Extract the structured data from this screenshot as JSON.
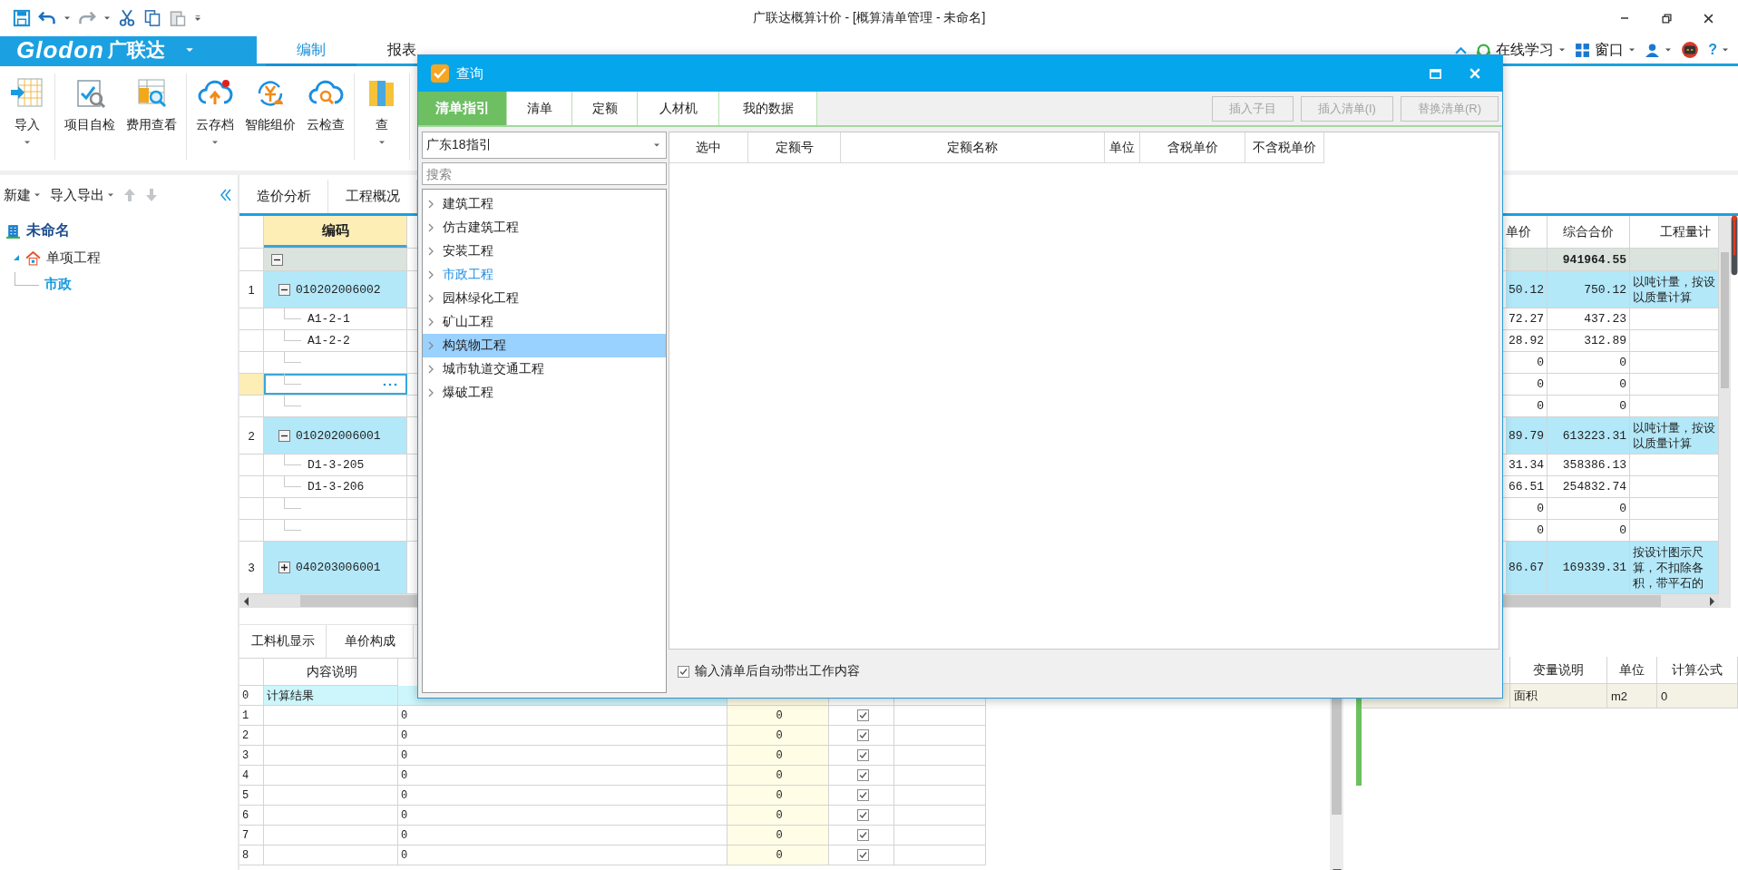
{
  "window": {
    "title": "广联达概算计价 - [概算清单管理 - 未命名]"
  },
  "logo": {
    "brand": "Glodon",
    "name": "广联达"
  },
  "ribbon_tabs": [
    {
      "label": "编制",
      "selected": true
    },
    {
      "label": "报表",
      "selected": false
    }
  ],
  "top_links": [
    {
      "kind": "learning",
      "label": "在线学习",
      "dropdown": true
    },
    {
      "kind": "window",
      "label": "窗口",
      "dropdown": true
    },
    {
      "kind": "user",
      "dropdown": true
    },
    {
      "kind": "assistant",
      "dropdown": false
    },
    {
      "kind": "help",
      "label": "?",
      "dropdown": true
    }
  ],
  "ribbon_groups": [
    {
      "buttons": [
        {
          "kind": "import",
          "label": "导入",
          "dropdown": true
        }
      ]
    },
    {
      "buttons": [
        {
          "kind": "self-check",
          "label": "项目自检",
          "dropdown": false
        },
        {
          "kind": "cost-view",
          "label": "费用查看",
          "dropdown": false
        }
      ]
    },
    {
      "buttons": [
        {
          "kind": "cloud-save",
          "label": "云存档",
          "dropdown": true
        },
        {
          "kind": "smart-price",
          "label": "智能组价",
          "dropdown": false
        },
        {
          "kind": "cloud-check",
          "label": "云检查",
          "dropdown": false
        }
      ]
    },
    {
      "buttons": [
        {
          "kind": "query",
          "label": "查",
          "dropdown": true
        }
      ]
    }
  ],
  "sidebar": {
    "toolbar": [
      {
        "label": "新建"
      },
      {
        "label": "导入导出"
      }
    ],
    "tree": [
      {
        "kind": "project",
        "label": "未命名",
        "children": [
          {
            "kind": "single",
            "label": "单项工程",
            "expanded": true,
            "children": [
              {
                "kind": "unit",
                "label": "市政",
                "selected": true
              }
            ]
          }
        ]
      }
    ]
  },
  "main_tabs": [
    {
      "label": "造价分析"
    },
    {
      "label": "工程概况"
    }
  ],
  "grid": {
    "columns": [
      "编码",
      "单价",
      "综合合价",
      "工程量计"
    ],
    "rows": [
      {
        "kind": "summary",
        "expanded": true,
        "total": "941964.55"
      },
      {
        "kind": "item",
        "number": "1",
        "code": "010202006002",
        "expanded": true,
        "price": "50.12",
        "total": "750.12",
        "note": [
          "以吨计量，按设",
          "以质量计算"
        ]
      },
      {
        "kind": "sub",
        "code": "A1-2-1",
        "price": "72.27",
        "total": "437.23"
      },
      {
        "kind": "sub",
        "code": "A1-2-2",
        "price": "28.92",
        "total": "312.89"
      },
      {
        "kind": "sub",
        "price": "0",
        "total": "0"
      },
      {
        "kind": "sub",
        "editing": true,
        "price": "0",
        "total": "0"
      },
      {
        "kind": "sub",
        "price": "0",
        "total": "0"
      },
      {
        "kind": "item",
        "number": "2",
        "code": "010202006001",
        "expanded": true,
        "price": "89.79",
        "total": "613223.31",
        "note": [
          "以吨计量，按设",
          "以质量计算"
        ]
      },
      {
        "kind": "sub",
        "code": "D1-3-205",
        "price": "31.34",
        "total": "358386.13"
      },
      {
        "kind": "sub",
        "code": "D1-3-206",
        "price": "66.51",
        "total": "254832.74"
      },
      {
        "kind": "sub",
        "price": "0",
        "total": "0"
      },
      {
        "kind": "sub",
        "price": "0",
        "total": "0"
      },
      {
        "kind": "item",
        "number": "3",
        "code": "040203006001",
        "expanded": false,
        "price": "86.67",
        "total": "169339.31",
        "note": [
          "按设计图示尺",
          "算，不扣除各",
          "积，带平石的"
        ]
      }
    ]
  },
  "detail_tabs": [
    {
      "label": "工料机显示"
    },
    {
      "label": "单价构成"
    }
  ],
  "calc_table": {
    "column": "内容说明",
    "rows": [
      {
        "kind": "result",
        "number": "0",
        "label": "计算结果"
      },
      {
        "kind": "item",
        "number": "1",
        "value": "0",
        "amount": "0",
        "checked": true
      },
      {
        "kind": "item",
        "number": "2",
        "value": "0",
        "amount": "0",
        "checked": true
      },
      {
        "kind": "item",
        "number": "3",
        "value": "0",
        "amount": "0",
        "checked": true
      },
      {
        "kind": "item",
        "number": "4",
        "value": "0",
        "amount": "0",
        "checked": true
      },
      {
        "kind": "item",
        "number": "5",
        "value": "0",
        "amount": "0",
        "checked": true
      },
      {
        "kind": "item",
        "number": "6",
        "value": "0",
        "amount": "0",
        "checked": true
      },
      {
        "kind": "item",
        "number": "7",
        "value": "0",
        "amount": "0",
        "checked": true
      },
      {
        "kind": "item",
        "number": "8",
        "value": "0",
        "amount": "0",
        "checked": true
      }
    ]
  },
  "variables": {
    "columns": [
      "变量说明",
      "单位",
      "计算公式"
    ],
    "rows": [
      {
        "label": "面积",
        "unit": "m2",
        "formula": "0"
      }
    ]
  },
  "query_dialog": {
    "title": "查询",
    "tabs": [
      {
        "label": "清单指引",
        "selected": true
      },
      {
        "label": "清单",
        "selected": false
      },
      {
        "label": "定额",
        "selected": false
      },
      {
        "label": "人材机",
        "selected": false
      },
      {
        "label": "我的数据",
        "selected": false
      }
    ],
    "buttons": [
      {
        "label": "插入子目",
        "disabled": true
      },
      {
        "label": "插入清单(I)",
        "disabled": true
      },
      {
        "label": "替换清单(R)",
        "disabled": true
      }
    ],
    "library": {
      "value": "广东18指引"
    },
    "search": {
      "placeholder": "搜索"
    },
    "categories": [
      {
        "label": "建筑工程",
        "current": false,
        "selected": false
      },
      {
        "label": "仿古建筑工程",
        "current": false,
        "selected": false
      },
      {
        "label": "安装工程",
        "current": false,
        "selected": false
      },
      {
        "label": "市政工程",
        "current": true,
        "selected": false
      },
      {
        "label": "园林绿化工程",
        "current": false,
        "selected": false
      },
      {
        "label": "矿山工程",
        "current": false,
        "selected": false
      },
      {
        "label": "构筑物工程",
        "current": false,
        "selected": true
      },
      {
        "label": "城市轨道交通工程",
        "current": false,
        "selected": false
      },
      {
        "label": "爆破工程",
        "current": false,
        "selected": false
      }
    ],
    "columns": [
      "选中",
      "定额号",
      "定额名称",
      "单位",
      "含税单价",
      "不含税单价"
    ],
    "auto_fill": {
      "label": "输入清单后自动带出工作内容",
      "checked": true
    }
  }
}
